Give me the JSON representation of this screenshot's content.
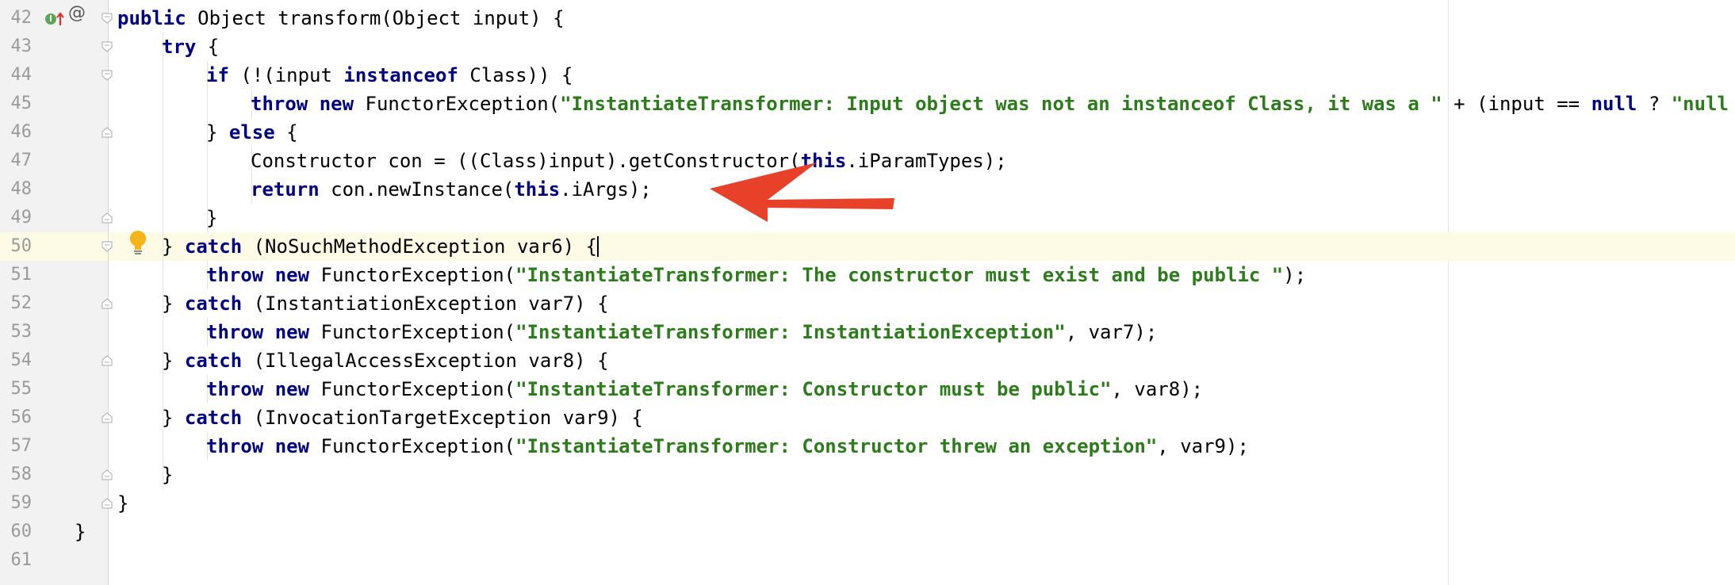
{
  "editor": {
    "current_line_index": 8,
    "lines": [
      {
        "num": "42",
        "indent": 1,
        "fold": "open",
        "tokens": [
          {
            "t": "public",
            "c": "kw"
          },
          {
            "t": " Object transform(Object input) {",
            "c": ""
          }
        ]
      },
      {
        "num": "43",
        "indent": 2,
        "fold": "open",
        "tokens": [
          {
            "t": "try",
            "c": "kw"
          },
          {
            "t": " {",
            "c": ""
          }
        ]
      },
      {
        "num": "44",
        "indent": 3,
        "fold": "open",
        "tokens": [
          {
            "t": "if",
            "c": "kw"
          },
          {
            "t": " (!(input ",
            "c": ""
          },
          {
            "t": "instanceof",
            "c": "kw"
          },
          {
            "t": " Class)) {",
            "c": ""
          }
        ]
      },
      {
        "num": "45",
        "indent": 4,
        "fold": "",
        "tokens": [
          {
            "t": "throw new",
            "c": "kw"
          },
          {
            "t": " FunctorException(",
            "c": ""
          },
          {
            "t": "\"InstantiateTransformer: Input object was not an instanceof Class, it was a \"",
            "c": "str"
          },
          {
            "t": " + (input == ",
            "c": ""
          },
          {
            "t": "null",
            "c": "kw"
          },
          {
            "t": " ? ",
            "c": ""
          },
          {
            "t": "\"null",
            "c": "str"
          }
        ]
      },
      {
        "num": "46",
        "indent": 3,
        "fold": "close",
        "tokens": [
          {
            "t": "} ",
            "c": ""
          },
          {
            "t": "else",
            "c": "kw"
          },
          {
            "t": " {",
            "c": ""
          }
        ]
      },
      {
        "num": "47",
        "indent": 4,
        "fold": "",
        "tokens": [
          {
            "t": "Constructor con = ((Class)input).getConstructor(",
            "c": ""
          },
          {
            "t": "this",
            "c": "kw"
          },
          {
            "t": ".iParamTypes);",
            "c": ""
          }
        ]
      },
      {
        "num": "48",
        "indent": 4,
        "fold": "",
        "tokens": [
          {
            "t": "return",
            "c": "kw"
          },
          {
            "t": " con.newInstance(",
            "c": ""
          },
          {
            "t": "this",
            "c": "kw"
          },
          {
            "t": ".iArgs);",
            "c": ""
          }
        ]
      },
      {
        "num": "49",
        "indent": 3,
        "fold": "close",
        "tokens": [
          {
            "t": "}",
            "c": ""
          }
        ]
      },
      {
        "num": "50",
        "indent": 2,
        "fold": "open",
        "tokens": [
          {
            "t": "} ",
            "c": ""
          },
          {
            "t": "catch",
            "c": "kw"
          },
          {
            "t": " (NoSuchMethodException var6) {",
            "c": ""
          },
          {
            "t": "",
            "c": "caret"
          }
        ]
      },
      {
        "num": "51",
        "indent": 3,
        "fold": "",
        "tokens": [
          {
            "t": "throw new",
            "c": "kw"
          },
          {
            "t": " FunctorException(",
            "c": ""
          },
          {
            "t": "\"InstantiateTransformer: The constructor must exist and be public \"",
            "c": "str"
          },
          {
            "t": ");",
            "c": ""
          }
        ]
      },
      {
        "num": "52",
        "indent": 2,
        "fold": "close",
        "tokens": [
          {
            "t": "} ",
            "c": ""
          },
          {
            "t": "catch",
            "c": "kw"
          },
          {
            "t": " (InstantiationException var7) {",
            "c": ""
          }
        ]
      },
      {
        "num": "53",
        "indent": 3,
        "fold": "",
        "tokens": [
          {
            "t": "throw new",
            "c": "kw"
          },
          {
            "t": " FunctorException(",
            "c": ""
          },
          {
            "t": "\"InstantiateTransformer: InstantiationException\"",
            "c": "str"
          },
          {
            "t": ", var7);",
            "c": ""
          }
        ]
      },
      {
        "num": "54",
        "indent": 2,
        "fold": "close",
        "tokens": [
          {
            "t": "} ",
            "c": ""
          },
          {
            "t": "catch",
            "c": "kw"
          },
          {
            "t": " (IllegalAccessException var8) {",
            "c": ""
          }
        ]
      },
      {
        "num": "55",
        "indent": 3,
        "fold": "",
        "tokens": [
          {
            "t": "throw new",
            "c": "kw"
          },
          {
            "t": " FunctorException(",
            "c": ""
          },
          {
            "t": "\"InstantiateTransformer: Constructor must be public\"",
            "c": "str"
          },
          {
            "t": ", var8);",
            "c": ""
          }
        ]
      },
      {
        "num": "56",
        "indent": 2,
        "fold": "close",
        "tokens": [
          {
            "t": "} ",
            "c": ""
          },
          {
            "t": "catch",
            "c": "kw"
          },
          {
            "t": " (InvocationTargetException var9) {",
            "c": ""
          }
        ]
      },
      {
        "num": "57",
        "indent": 3,
        "fold": "",
        "tokens": [
          {
            "t": "throw new",
            "c": "kw"
          },
          {
            "t": " FunctorException(",
            "c": ""
          },
          {
            "t": "\"InstantiateTransformer: Constructor threw an exception\"",
            "c": "str"
          },
          {
            "t": ", var9);",
            "c": ""
          }
        ]
      },
      {
        "num": "58",
        "indent": 2,
        "fold": "close",
        "tokens": [
          {
            "t": "}",
            "c": ""
          }
        ]
      },
      {
        "num": "59",
        "indent": 1,
        "fold": "close",
        "tokens": [
          {
            "t": "}",
            "c": ""
          }
        ]
      },
      {
        "num": "60",
        "indent": 0,
        "fold": "",
        "tokens": [
          {
            "t": "}",
            "c": ""
          }
        ]
      },
      {
        "num": "61",
        "indent": 0,
        "fold": "",
        "tokens": []
      }
    ]
  },
  "gutter_icons": {
    "implements_icon": "implements-override-icon",
    "annotation_icon": "at-annotation-icon",
    "annotation_glyph": "@",
    "intention_icon": "lightbulb-icon"
  },
  "annotation": {
    "arrow_icon": "red-arrow-icon",
    "color": "#e8412a"
  },
  "colors": {
    "keyword": "#000080",
    "string": "#2c7c1b",
    "current_line": "#fdfbe6",
    "gutter": "#f2f2f2"
  }
}
